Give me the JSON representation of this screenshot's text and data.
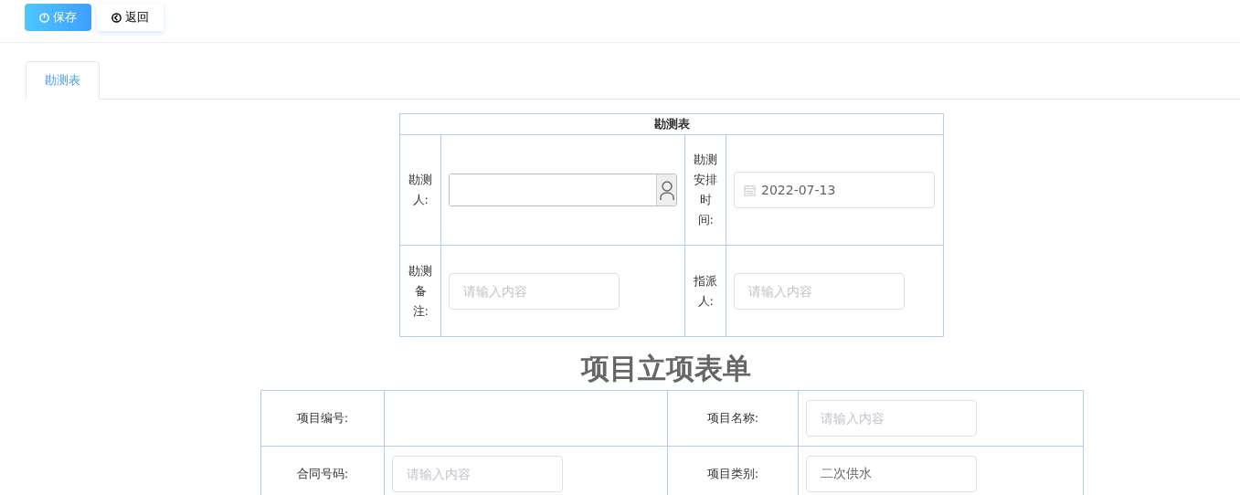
{
  "toolbar": {
    "buttons": [
      {
        "label": "保存",
        "kind": "primary"
      },
      {
        "label": "返回",
        "kind": "default"
      }
    ]
  },
  "tabs": [
    {
      "label": "勘测表",
      "selected": true
    }
  ],
  "survey_form": {
    "title": "勘测表",
    "rows": [
      [
        {
          "label": "勘测人:",
          "field": {
            "kind": "person"
          }
        },
        {
          "label": "勘测安排时间:",
          "field": {
            "kind": "date",
            "value": "2022-07-13"
          }
        }
      ],
      [
        {
          "label": "勘测备注:",
          "field": {
            "kind": "text",
            "placeholder": "请输入内容"
          }
        },
        {
          "label": "指派人:",
          "field": {
            "kind": "text",
            "placeholder": "请输入内容"
          }
        }
      ]
    ]
  },
  "project_form": {
    "title": "项目立项表单",
    "rows": [
      [
        {
          "label": "项目编号:"
        },
        {
          "label": "项目名称:",
          "field": {
            "kind": "text",
            "placeholder": "请输入内容"
          }
        }
      ],
      [
        {
          "label": "合同号码:",
          "field": {
            "kind": "text",
            "placeholder": "请输入内容"
          }
        },
        {
          "label": "项目类别:",
          "field": {
            "kind": "text",
            "value": "二次供水"
          }
        }
      ]
    ]
  }
}
